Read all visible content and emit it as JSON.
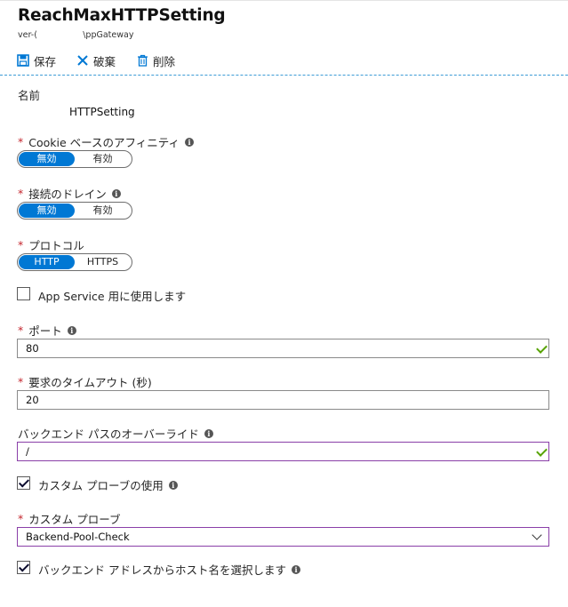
{
  "header": {
    "title": "ReachMaxHTTPSetting",
    "subtitle": "ver-(                 \\ppGateway"
  },
  "toolbar": {
    "save_label": "保存",
    "discard_label": "破棄",
    "delete_label": "削除"
  },
  "form": {
    "name": {
      "label": "名前",
      "value": "HTTPSetting"
    },
    "cookie_affinity": {
      "label": "Cookie ベースのアフィニティ",
      "options": [
        "無効",
        "有効"
      ],
      "selected": "無効"
    },
    "connection_draining": {
      "label": "接続のドレイン",
      "options": [
        "無効",
        "有効"
      ],
      "selected": "無効"
    },
    "protocol": {
      "label": "プロトコル",
      "options": [
        "HTTP",
        "HTTPS"
      ],
      "selected": "HTTP"
    },
    "app_service": {
      "label": "App Service 用に使用します",
      "checked": false
    },
    "port": {
      "label": "ポート",
      "value": "80"
    },
    "timeout": {
      "label": "要求のタイムアウト (秒)",
      "value": "20"
    },
    "backend_path_override": {
      "label": "バックエンド パスのオーバーライド",
      "value": "/"
    },
    "use_custom_probe": {
      "label": "カスタム プローブの使用",
      "checked": true
    },
    "custom_probe": {
      "label": "カスタム プローブ",
      "selected": "Backend-Pool-Check"
    },
    "pick_host_from_backend": {
      "label": "バックエンド アドレスからホスト名を選択します",
      "checked": true
    }
  },
  "colors": {
    "accent": "#0078d4",
    "required": "#c4262e",
    "valid": "#57a300",
    "focus_border": "#8a3fa8"
  }
}
